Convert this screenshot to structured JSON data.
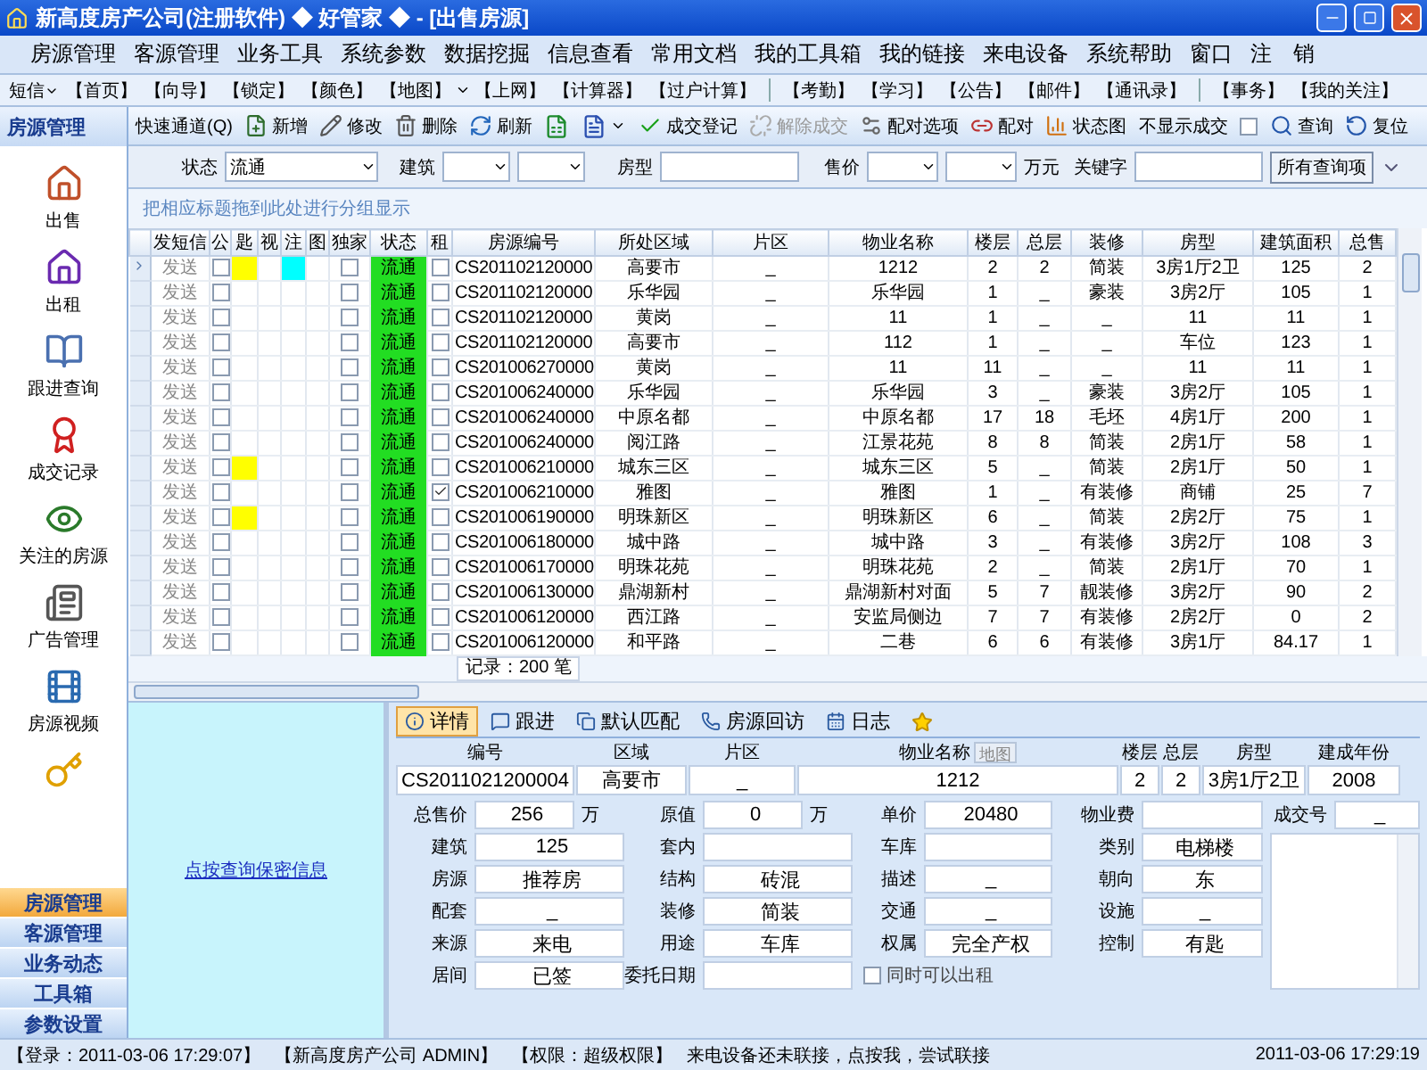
{
  "window": {
    "title": "新高度房产公司(注册软件) ◆ 好管家 ◆ - [出售房源]"
  },
  "menu": [
    "房源管理",
    "客源管理",
    "业务工具",
    "系统参数",
    "数据挖掘",
    "信息查看",
    "常用文档",
    "我的工具箱",
    "我的链接",
    "来电设备",
    "系统帮助",
    "窗口",
    "注　销"
  ],
  "quickbar": {
    "sms": "短信",
    "groups": [
      [
        {
          "label": "【首页】"
        },
        {
          "label": "【向导】"
        },
        {
          "label": "【锁定】"
        },
        {
          "label": "【颜色】"
        },
        {
          "label": "【地图】",
          "dropdown": true
        },
        {
          "label": "【上网】"
        },
        {
          "label": "【计算器】"
        },
        {
          "label": "【过户计算】"
        }
      ],
      [
        {
          "label": "【考勤】"
        },
        {
          "label": "【学习】"
        },
        {
          "label": "【公告】"
        },
        {
          "label": "【邮件】"
        },
        {
          "label": "【通讯录】"
        }
      ],
      [
        {
          "label": "【事务】"
        },
        {
          "label": "【我的关注】"
        }
      ]
    ]
  },
  "sidebar": {
    "title": "房源管理",
    "items": [
      "出售",
      "出租",
      "跟进查询",
      "成交记录",
      "关注的房源",
      "广告管理",
      "房源视频"
    ]
  },
  "nav": [
    {
      "label": "房源管理",
      "selected": true
    },
    {
      "label": "客源管理",
      "selected": false
    },
    {
      "label": "业务动态",
      "selected": false
    },
    {
      "label": "工具箱",
      "selected": false
    },
    {
      "label": "参数设置",
      "selected": false
    }
  ],
  "toolbar": [
    {
      "kind": "label",
      "label": "快速通道(Q)"
    },
    {
      "kind": "button",
      "label": "新增",
      "disabled": false
    },
    {
      "kind": "button",
      "label": "修改",
      "disabled": false
    },
    {
      "kind": "button",
      "label": "删除",
      "disabled": false
    },
    {
      "kind": "button",
      "label": "刷新",
      "disabled": false
    },
    {
      "kind": "icon"
    },
    {
      "kind": "icon_menu"
    },
    {
      "kind": "button",
      "label": "成交登记",
      "disabled": false
    },
    {
      "kind": "button",
      "label": "解除成交",
      "disabled": true
    },
    {
      "kind": "button",
      "label": "配对选项",
      "disabled": false
    },
    {
      "kind": "button",
      "label": "配对",
      "disabled": false
    },
    {
      "kind": "button",
      "label": "状态图",
      "disabled": false
    },
    {
      "kind": "checkbox",
      "label": "不显示成交",
      "checked": false
    },
    {
      "kind": "button",
      "label": "查询",
      "disabled": false
    },
    {
      "kind": "button",
      "label": "复位",
      "disabled": false
    }
  ],
  "filters": {
    "status_label": "状态",
    "status_value": "流通",
    "building_label": "建筑",
    "type_label": "房型",
    "price_label": "售价",
    "price_unit": "万元",
    "keyword_label": "关键字",
    "all_button": "所有查询项"
  },
  "group_hint": "把相应标题拖到此处进行分组显示",
  "table": {
    "columns": [
      "发短信",
      "公",
      "匙",
      "视",
      "注",
      "图",
      "独家",
      "状态",
      "租",
      "房源编号",
      "所处区域",
      "片区",
      "物业名称",
      "楼层",
      "总层",
      "装修",
      "房型",
      "建筑面积",
      "总售"
    ],
    "rows": [
      {
        "selected": true,
        "cells": [
          "发送",
          {
            "kind": "check",
            "checked": false
          },
          {
            "kind": "marker",
            "on": true
          },
          {
            "kind": "marker",
            "on": false
          },
          {
            "kind": "marker",
            "on": true
          },
          {
            "kind": "marker",
            "on": false
          },
          {
            "kind": "check",
            "checked": false
          },
          "流通",
          {
            "kind": "check",
            "checked": false
          },
          "CS201102120000",
          "高要市",
          "_",
          "1212",
          "2",
          "2",
          "简装",
          "3房1厅2卫",
          "125",
          "2"
        ]
      },
      {
        "selected": false,
        "cells": [
          "发送",
          {
            "kind": "check",
            "checked": false
          },
          {
            "kind": "marker",
            "on": false
          },
          {
            "kind": "marker",
            "on": false
          },
          {
            "kind": "marker",
            "on": false
          },
          {
            "kind": "marker",
            "on": false
          },
          {
            "kind": "check",
            "checked": false
          },
          "流通",
          {
            "kind": "check",
            "checked": false
          },
          "CS201102120000",
          "乐华园",
          "_",
          "乐华园",
          "1",
          "_",
          "豪装",
          "3房2厅",
          "105",
          "1"
        ]
      },
      {
        "selected": false,
        "cells": [
          "发送",
          {
            "kind": "check",
            "checked": false
          },
          {
            "kind": "marker",
            "on": false
          },
          {
            "kind": "marker",
            "on": false
          },
          {
            "kind": "marker",
            "on": false
          },
          {
            "kind": "marker",
            "on": false
          },
          {
            "kind": "check",
            "checked": false
          },
          "流通",
          {
            "kind": "check",
            "checked": false
          },
          "CS201102120000",
          "黄岗",
          "_",
          "11",
          "1",
          "_",
          "_",
          "11",
          "11",
          "1"
        ]
      },
      {
        "selected": false,
        "cells": [
          "发送",
          {
            "kind": "check",
            "checked": false
          },
          {
            "kind": "marker",
            "on": false
          },
          {
            "kind": "marker",
            "on": false
          },
          {
            "kind": "marker",
            "on": false
          },
          {
            "kind": "marker",
            "on": false
          },
          {
            "kind": "check",
            "checked": false
          },
          "流通",
          {
            "kind": "check",
            "checked": false
          },
          "CS201102120000",
          "高要市",
          "_",
          "112",
          "1",
          "_",
          "_",
          "车位",
          "123",
          "1"
        ]
      },
      {
        "selected": false,
        "cells": [
          "发送",
          {
            "kind": "check",
            "checked": false
          },
          {
            "kind": "marker",
            "on": false
          },
          {
            "kind": "marker",
            "on": false
          },
          {
            "kind": "marker",
            "on": false
          },
          {
            "kind": "marker",
            "on": false
          },
          {
            "kind": "check",
            "checked": false
          },
          "流通",
          {
            "kind": "check",
            "checked": false
          },
          "CS201006270000",
          "黄岗",
          "_",
          "11",
          "11",
          "_",
          "_",
          "11",
          "11",
          "1"
        ]
      },
      {
        "selected": false,
        "cells": [
          "发送",
          {
            "kind": "check",
            "checked": false
          },
          {
            "kind": "marker",
            "on": false
          },
          {
            "kind": "marker",
            "on": false
          },
          {
            "kind": "marker",
            "on": false
          },
          {
            "kind": "marker",
            "on": false
          },
          {
            "kind": "check",
            "checked": false
          },
          "流通",
          {
            "kind": "check",
            "checked": false
          },
          "CS201006240000",
          "乐华园",
          "_",
          "乐华园",
          "3",
          "_",
          "豪装",
          "3房2厅",
          "105",
          "1"
        ]
      },
      {
        "selected": false,
        "cells": [
          "发送",
          {
            "kind": "check",
            "checked": false
          },
          {
            "kind": "marker",
            "on": false
          },
          {
            "kind": "marker",
            "on": false
          },
          {
            "kind": "marker",
            "on": false
          },
          {
            "kind": "marker",
            "on": false
          },
          {
            "kind": "check",
            "checked": false
          },
          "流通",
          {
            "kind": "check",
            "checked": false
          },
          "CS201006240000",
          "中原名都",
          "_",
          "中原名都",
          "17",
          "18",
          "毛坯",
          "4房1厅",
          "200",
          "1"
        ]
      },
      {
        "selected": false,
        "cells": [
          "发送",
          {
            "kind": "check",
            "checked": false
          },
          {
            "kind": "marker",
            "on": false
          },
          {
            "kind": "marker",
            "on": false
          },
          {
            "kind": "marker",
            "on": false
          },
          {
            "kind": "marker",
            "on": false
          },
          {
            "kind": "check",
            "checked": false
          },
          "流通",
          {
            "kind": "check",
            "checked": false
          },
          "CS201006240000",
          "阅江路",
          "_",
          "江景花苑",
          "8",
          "8",
          "简装",
          "2房1厅",
          "58",
          "1"
        ]
      },
      {
        "selected": false,
        "cells": [
          "发送",
          {
            "kind": "check",
            "checked": false
          },
          {
            "kind": "marker",
            "on": true
          },
          {
            "kind": "marker",
            "on": false
          },
          {
            "kind": "marker",
            "on": false
          },
          {
            "kind": "marker",
            "on": false
          },
          {
            "kind": "check",
            "checked": false
          },
          "流通",
          {
            "kind": "check",
            "checked": false
          },
          "CS201006210000",
          "城东三区",
          "_",
          "城东三区",
          "5",
          "_",
          "简装",
          "2房1厅",
          "50",
          "1"
        ]
      },
      {
        "selected": false,
        "cells": [
          "发送",
          {
            "kind": "check",
            "checked": false
          },
          {
            "kind": "marker",
            "on": false
          },
          {
            "kind": "marker",
            "on": false
          },
          {
            "kind": "marker",
            "on": false
          },
          {
            "kind": "marker",
            "on": false
          },
          {
            "kind": "check",
            "checked": false
          },
          "流通",
          {
            "kind": "check",
            "checked": true
          },
          "CS201006210000",
          "雅图",
          "_",
          "雅图",
          "1",
          "_",
          "有装修",
          "商铺",
          "25",
          "7"
        ]
      },
      {
        "selected": false,
        "cells": [
          "发送",
          {
            "kind": "check",
            "checked": false
          },
          {
            "kind": "marker",
            "on": true
          },
          {
            "kind": "marker",
            "on": false
          },
          {
            "kind": "marker",
            "on": false
          },
          {
            "kind": "marker",
            "on": false
          },
          {
            "kind": "check",
            "checked": false
          },
          "流通",
          {
            "kind": "check",
            "checked": false
          },
          "CS201006190000",
          "明珠新区",
          "_",
          "明珠新区",
          "6",
          "_",
          "简装",
          "2房2厅",
          "75",
          "1"
        ]
      },
      {
        "selected": false,
        "cells": [
          "发送",
          {
            "kind": "check",
            "checked": false
          },
          {
            "kind": "marker",
            "on": false
          },
          {
            "kind": "marker",
            "on": false
          },
          {
            "kind": "marker",
            "on": false
          },
          {
            "kind": "marker",
            "on": false
          },
          {
            "kind": "check",
            "checked": false
          },
          "流通",
          {
            "kind": "check",
            "checked": false
          },
          "CS201006180000",
          "城中路",
          "_",
          "城中路",
          "3",
          "_",
          "有装修",
          "3房2厅",
          "108",
          "3"
        ]
      },
      {
        "selected": false,
        "cells": [
          "发送",
          {
            "kind": "check",
            "checked": false
          },
          {
            "kind": "marker",
            "on": false
          },
          {
            "kind": "marker",
            "on": false
          },
          {
            "kind": "marker",
            "on": false
          },
          {
            "kind": "marker",
            "on": false
          },
          {
            "kind": "check",
            "checked": false
          },
          "流通",
          {
            "kind": "check",
            "checked": false
          },
          "CS201006170000",
          "明珠花苑",
          "_",
          "明珠花苑",
          "2",
          "_",
          "简装",
          "2房1厅",
          "70",
          "1"
        ]
      },
      {
        "selected": false,
        "cells": [
          "发送",
          {
            "kind": "check",
            "checked": false
          },
          {
            "kind": "marker",
            "on": false
          },
          {
            "kind": "marker",
            "on": false
          },
          {
            "kind": "marker",
            "on": false
          },
          {
            "kind": "marker",
            "on": false
          },
          {
            "kind": "check",
            "checked": false
          },
          "流通",
          {
            "kind": "check",
            "checked": false
          },
          "CS201006130000",
          "鼎湖新村",
          "_",
          "鼎湖新村对面",
          "5",
          "7",
          "靓装修",
          "3房2厅",
          "90",
          "2"
        ]
      },
      {
        "selected": false,
        "cells": [
          "发送",
          {
            "kind": "check",
            "checked": false
          },
          {
            "kind": "marker",
            "on": false
          },
          {
            "kind": "marker",
            "on": false
          },
          {
            "kind": "marker",
            "on": false
          },
          {
            "kind": "marker",
            "on": false
          },
          {
            "kind": "check",
            "checked": false
          },
          "流通",
          {
            "kind": "check",
            "checked": false
          },
          "CS201006120000",
          "西江路",
          "_",
          "安监局侧边",
          "7",
          "7",
          "有装修",
          "2房2厅",
          "0",
          "2"
        ]
      },
      {
        "selected": false,
        "cells": [
          "发送",
          {
            "kind": "check",
            "checked": false
          },
          {
            "kind": "marker",
            "on": false
          },
          {
            "kind": "marker",
            "on": false
          },
          {
            "kind": "marker",
            "on": false
          },
          {
            "kind": "marker",
            "on": false
          },
          {
            "kind": "check",
            "checked": false
          },
          "流通",
          {
            "kind": "check",
            "checked": false
          },
          "CS201006120000",
          "和平路",
          "_",
          "二巷",
          "6",
          "6",
          "有装修",
          "3房1厅",
          "84.17",
          "1"
        ]
      }
    ],
    "record_count": "记录：200 笔"
  },
  "secret_link": "点按查询保密信息",
  "detail": {
    "tabs": [
      {
        "label": "详情",
        "selected": true
      },
      {
        "label": "跟进",
        "selected": false
      },
      {
        "label": "默认匹配",
        "selected": false
      },
      {
        "label": "房源回访",
        "selected": false
      },
      {
        "label": "日志",
        "selected": false
      }
    ],
    "header": [
      {
        "label": "编号",
        "value": "CS2011021200004"
      },
      {
        "label": "区域",
        "value": "高要市"
      },
      {
        "label": "片区",
        "value": "_"
      },
      {
        "label": "物业名称",
        "value": "1212",
        "button": "地图"
      },
      {
        "label": "楼层",
        "value": "2"
      },
      {
        "label": "总层",
        "value": "2"
      },
      {
        "label": "房型",
        "value": "3房1厅2卫"
      },
      {
        "label": "建成年份",
        "value": "2008"
      }
    ],
    "fields": [
      [
        {
          "label": "总售价",
          "value": "256",
          "unit": "万"
        },
        {
          "label": "原值",
          "value": "0",
          "unit": "万"
        },
        {
          "label": "单价",
          "value": "20480"
        },
        {
          "label": "物业费"
        },
        {
          "label": "成交号",
          "value": "_"
        }
      ],
      [
        {
          "label": "建筑",
          "value": "125"
        },
        {
          "label": "套内"
        },
        {
          "label": "车库"
        },
        {
          "label": "类别",
          "value": "电梯楼"
        }
      ],
      [
        {
          "label": "房源",
          "value": "推荐房"
        },
        {
          "label": "结构",
          "value": "砖混"
        },
        {
          "label": "描述",
          "value": "_"
        },
        {
          "label": "朝向",
          "value": "东"
        }
      ],
      [
        {
          "label": "配套",
          "value": "_"
        },
        {
          "label": "装修",
          "value": "简装"
        },
        {
          "label": "交通",
          "value": "_"
        },
        {
          "label": "设施",
          "value": "_"
        }
      ],
      [
        {
          "label": "来源",
          "value": "来电"
        },
        {
          "label": "用途",
          "value": "车库"
        },
        {
          "label": "权属",
          "value": "完全产权"
        },
        {
          "label": "控制",
          "value": "有匙"
        }
      ],
      [
        {
          "label": "居间",
          "value": "已签"
        },
        {
          "label": "委托日期"
        }
      ]
    ],
    "rent_too": {
      "label": "同时可以出租",
      "checked": false
    }
  },
  "status_bar": [
    "【登录：2011-03-06 17:29:07】",
    "【新高度房产公司  ADMIN】",
    "【权限：超级权限】",
    "来电设备还未联接，点按我，尝试联接"
  ],
  "clock": "2011-03-06 17:29:19"
}
